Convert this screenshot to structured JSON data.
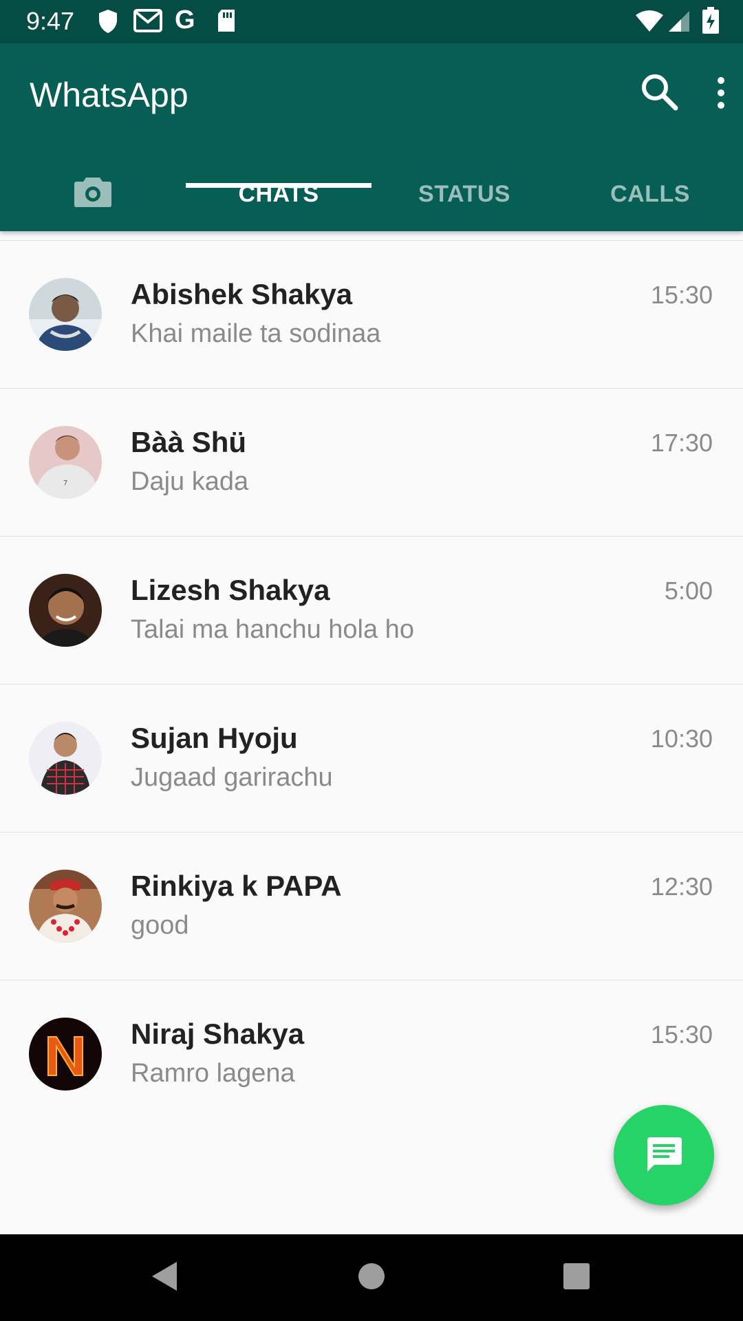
{
  "status_bar": {
    "time": "9:47",
    "icons_left": [
      "shield-icon",
      "gmail-icon",
      "google-icon",
      "sd-card-icon"
    ],
    "icons_right": [
      "wifi-icon",
      "signal-icon",
      "battery-charging-icon"
    ]
  },
  "app_bar": {
    "title": "WhatsApp",
    "search_icon": "search-icon",
    "menu_icon": "more-vert-icon"
  },
  "tabs": {
    "camera_icon": "camera-icon",
    "items": [
      {
        "label": "CHATS",
        "active": true
      },
      {
        "label": "STATUS",
        "active": false
      },
      {
        "label": "CALLS",
        "active": false
      }
    ]
  },
  "chats": [
    {
      "name": "Abishek Shakya",
      "message": "Khai maile ta sodinaa",
      "time": "15:30"
    },
    {
      "name": "Bàà Shü",
      "message": "Daju kada",
      "time": "17:30"
    },
    {
      "name": "Lizesh Shakya",
      "message": "Talai ma hanchu hola ho",
      "time": "5:00"
    },
    {
      "name": "Sujan Hyoju",
      "message": "Jugaad garirachu",
      "time": "10:30"
    },
    {
      "name": "Rinkiya k PAPA",
      "message": "good",
      "time": "12:30"
    },
    {
      "name": "Niraj Shakya",
      "message": "Ramro lagena",
      "time": "15:30"
    }
  ],
  "fab": {
    "icon": "new-chat-icon"
  },
  "nav_bar": {
    "icons": [
      "back-icon",
      "home-icon",
      "recents-icon"
    ]
  },
  "colors": {
    "primary_dark": "#054d44",
    "primary": "#075e54",
    "fab": "#25d366",
    "secondary_text": "#8a8a8a"
  }
}
